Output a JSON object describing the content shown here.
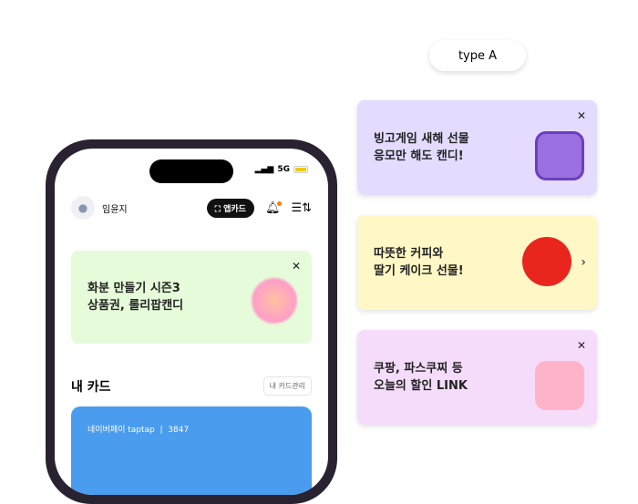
{
  "phone": {
    "status": {
      "network": "5G"
    },
    "user": "임윤지",
    "app_card": "앱카드",
    "banner": {
      "line1": "화분 만들기 시즌3",
      "line2": "상품권, 롤리팝캔디",
      "color": "#e6fbd9"
    },
    "section_title": "내 카드",
    "manage": "내 카드관리",
    "card": {
      "name": "네이버페이 taptap",
      "number": "3847",
      "color": "#4a9cee"
    }
  },
  "type_label": "type A",
  "banners": [
    {
      "line1": "빙고게임 새해 선물",
      "line2": "응모만 해도 캔디!",
      "color": "#e4dbff",
      "action": "close"
    },
    {
      "line1": "따뜻한 커피와",
      "line2": "딸기 케이크 선물!",
      "color": "#fff8c6",
      "action": "chevron"
    },
    {
      "line1": "쿠팡, 파스쿠찌 등",
      "line2": "오늘의 할인 LINK",
      "color": "#f6dcfb",
      "action": "close"
    }
  ]
}
